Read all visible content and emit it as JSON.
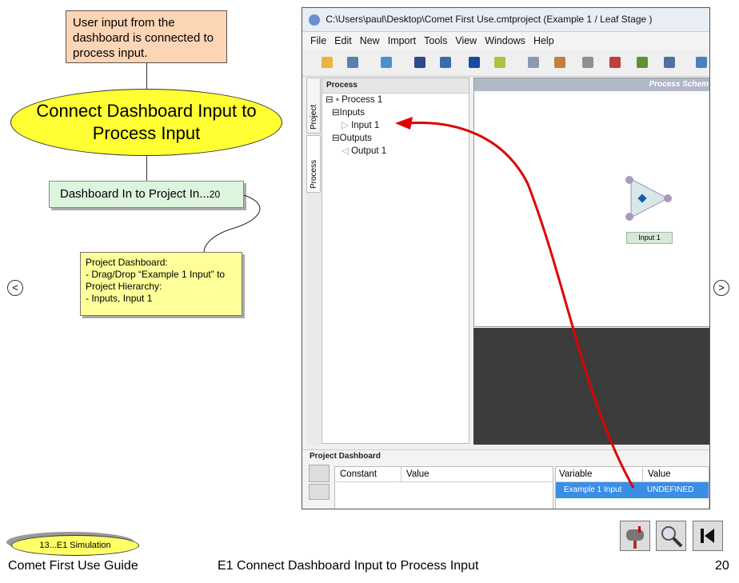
{
  "flow": {
    "top_note": "User input from the dashboard is connected to process input.",
    "ellipse_title": "Connect Dashboard Input to Process Input",
    "step_box_label": "Dashboard In to Project In...",
    "step_box_num": "20",
    "instruction_note": "Project Dashboard:\n- Drag/Drop “Example 1 Input” to Project Hierarchy:\n- Inputs, Input 1"
  },
  "nav": {
    "prev": "<",
    "next": ">"
  },
  "app": {
    "title": "C:\\Users\\paul\\Desktop\\Comet First Use.cmtproject (Example 1 / Leaf Stage )",
    "menu": [
      "File",
      "Edit",
      "New",
      "Import",
      "Tools",
      "View",
      "Windows",
      "Help"
    ],
    "process_panel_title": "Process",
    "tabs": [
      "Project",
      "Process"
    ],
    "tree": {
      "root": "Process 1",
      "inputs": "Inputs",
      "input1": "Input 1",
      "outputs": "Outputs",
      "output1": "Output 1"
    },
    "schematic_title": "Process Schem",
    "node_label": "Input 1",
    "dashboard_title": "Project Dashboard",
    "const_headers": [
      "Constant",
      "Value"
    ],
    "var_headers": [
      "Variable",
      "Value"
    ],
    "var_row": {
      "variable": "Example 1 Input",
      "value": "UNDEFINED"
    }
  },
  "footer": {
    "breadcrumb": "13...E1 Simulation",
    "guide": "Comet First Use Guide",
    "page_title": "E1 Connect Dashboard Input to Process Input",
    "page_number": "20"
  },
  "colors": {
    "accent_red": "#e00000",
    "selection_blue": "#3a8ee6"
  }
}
